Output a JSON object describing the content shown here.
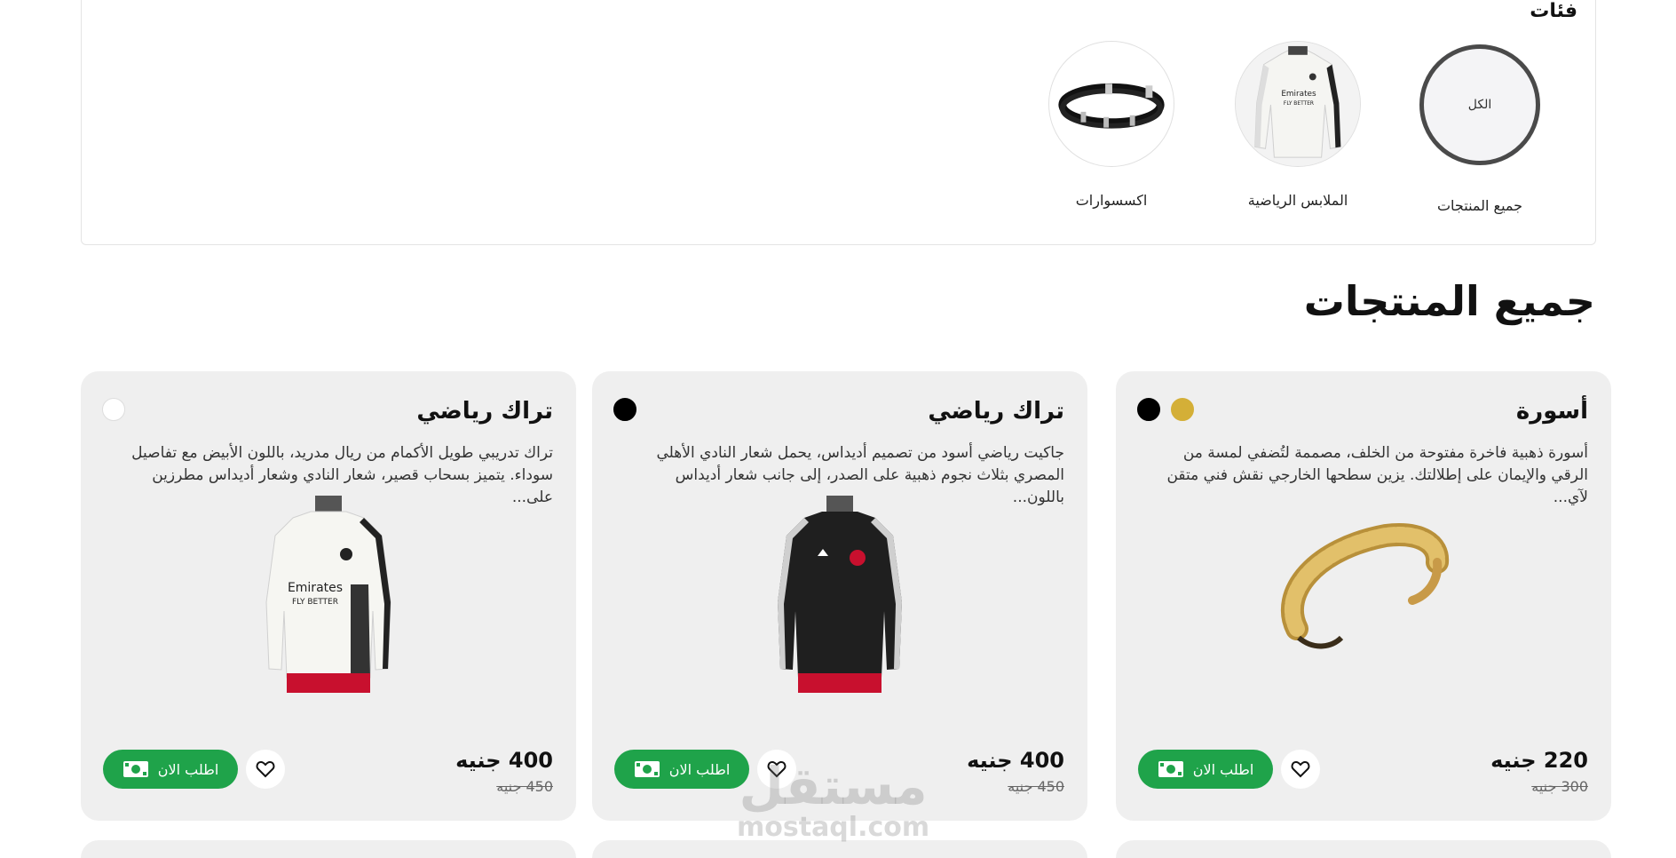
{
  "categories": {
    "title": "فئات",
    "items": [
      {
        "label": "جميع المنتجات",
        "circle_text": "الكل",
        "active": true
      },
      {
        "label": "الملابس الرياضية"
      },
      {
        "label": "اكسسوارات"
      }
    ]
  },
  "section_title": "جميع المنتجات",
  "products": [
    {
      "title": "أسورة",
      "description": "أسورة ذهبية فاخرة مفتوحة من الخلف، مصممة لتُضفي لمسة من الرقي والإيمان على إطلالتك. يزين سطحها الخارجي نقش فني متقن لآي...",
      "price": "220 جنيه",
      "old_price": "300 جنيه",
      "swatches": [
        "#d4af37",
        "#000000"
      ],
      "order_label": "اطلب الان",
      "image": "gold-bracelet"
    },
    {
      "title": "تراك رياضي",
      "description": "جاكيت رياضي أسود من تصميم أديداس، يحمل شعار النادي الأهلي المصري بثلاث نجوم ذهبية على الصدر، إلى جانب شعار أديداس باللون...",
      "price": "400 جنيه",
      "old_price": "450 جنيه",
      "swatches": [
        "#000000"
      ],
      "order_label": "اطلب الان",
      "image": "black-track-jacket"
    },
    {
      "title": "تراك رياضي",
      "description": "تراك تدريبي طويل الأكمام من ريال مدريد، باللون الأبيض مع تفاصيل سوداء. يتميز بسحاب قصير، شعار النادي وشعار أديداس مطرزين على...",
      "price": "400 جنيه",
      "old_price": "450 جنيه",
      "swatches": [
        "#ffffff"
      ],
      "order_label": "اطلب الان",
      "image": "white-track-jacket"
    }
  ],
  "watermark": {
    "ar": "مستقل",
    "en": "mostaql.com"
  },
  "colors": {
    "accent_green": "#1fa34a",
    "card_bg": "#efefef"
  }
}
